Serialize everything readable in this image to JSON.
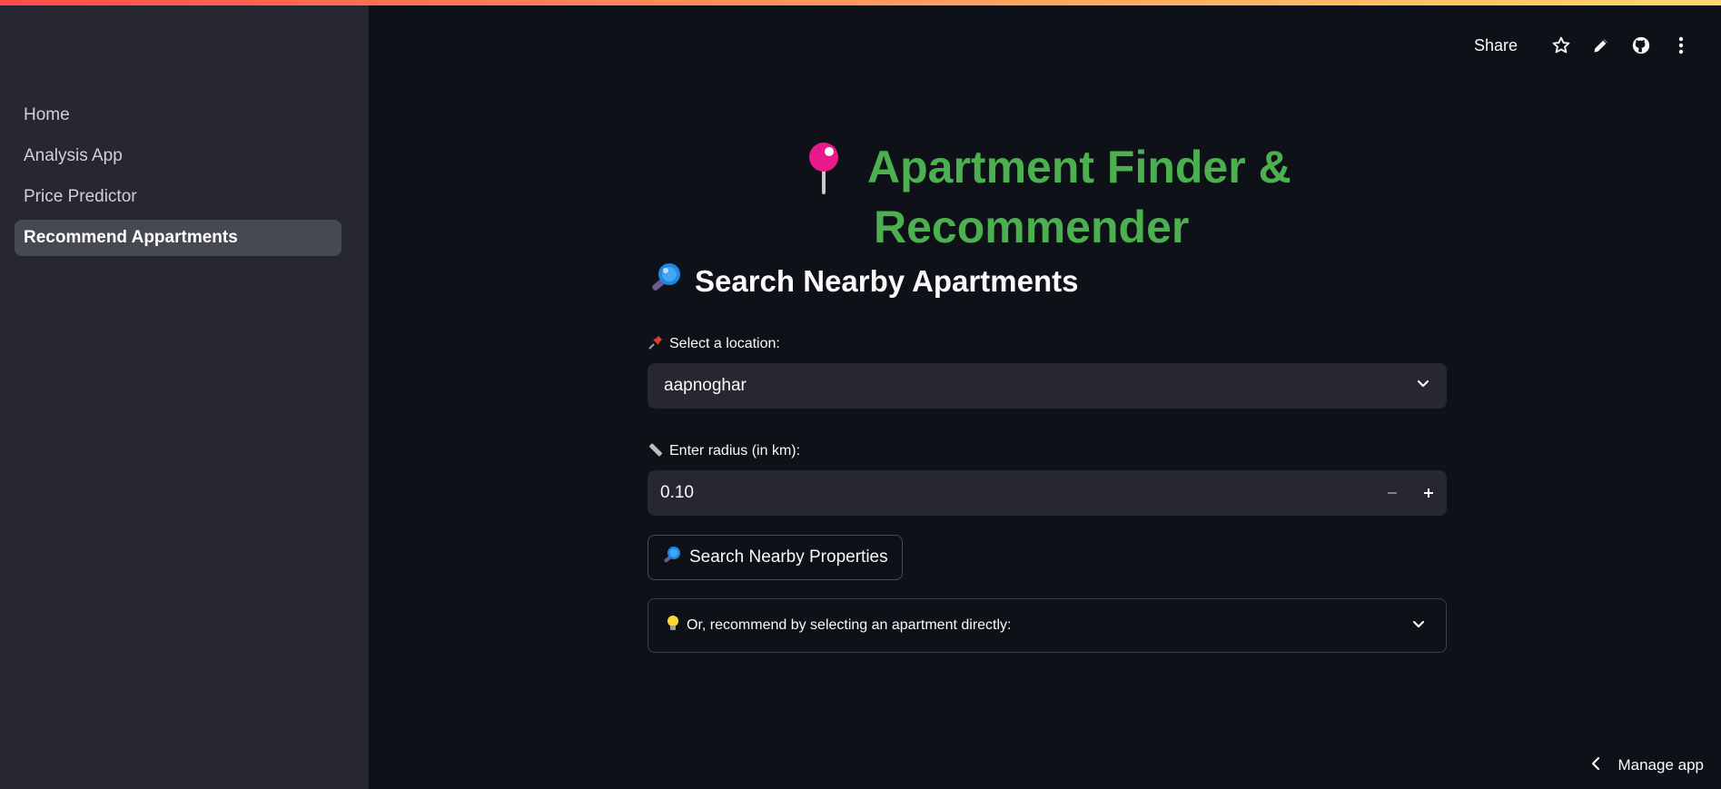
{
  "sidebar": {
    "items": [
      {
        "label": "Home",
        "active": false
      },
      {
        "label": "Analysis App",
        "active": false
      },
      {
        "label": "Price Predictor",
        "active": false
      },
      {
        "label": "Recommend Appartments",
        "active": true
      }
    ]
  },
  "header": {
    "share_label": "Share",
    "icons": [
      "star-icon",
      "pencil-icon",
      "github-icon",
      "kebab-menu-icon"
    ]
  },
  "main": {
    "title_line1": "Apartment Finder &",
    "title_line2": "Recommender",
    "title_icon": "round-pushpin-emoji",
    "subheader": "Search Nearby Apartments",
    "subheader_icon": "magnifier-emoji",
    "location": {
      "label": "Select a location:",
      "icon": "pushpin-emoji",
      "value": "aapnoghar"
    },
    "radius": {
      "label": "Enter radius (in km):",
      "icon": "ruler-emoji",
      "value": "0.10"
    },
    "search_button": {
      "label": "Search Nearby Properties",
      "icon": "magnifier-emoji"
    },
    "expander": {
      "label": "Or, recommend by selecting an apartment directly:",
      "icon": "lightbulb-emoji"
    }
  },
  "footer": {
    "manage_label": "Manage app"
  },
  "colors": {
    "background": "#0e1117",
    "sidebar": "#262730",
    "title_green": "#4caf50",
    "input_bg": "#262730"
  }
}
